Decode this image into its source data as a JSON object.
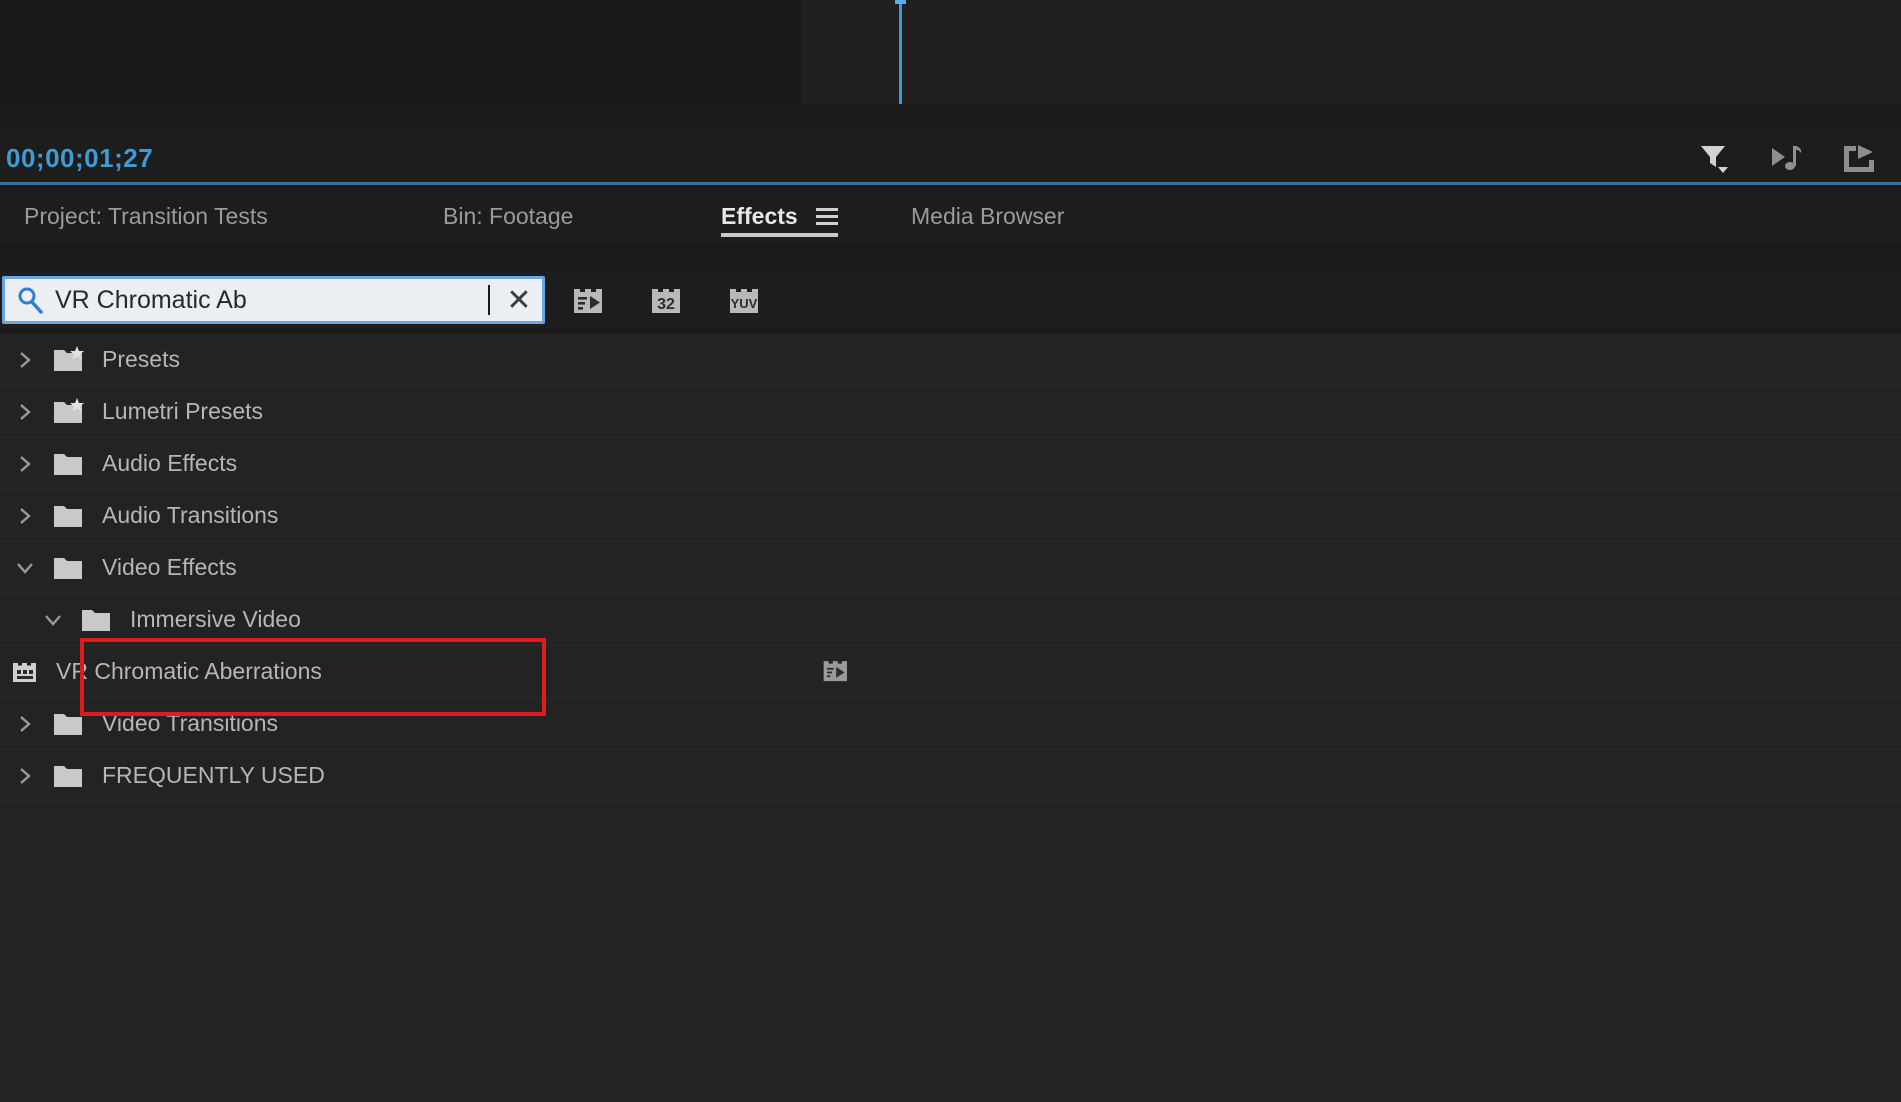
{
  "app": {
    "name": "Adobe Premiere Pro",
    "panel": "Effects"
  },
  "timeline": {
    "timecode": "00;00;01;27",
    "timecode_color": "#3f9bd4",
    "playhead_color": "#3f9bd4",
    "icons": [
      {
        "name": "filter-funnel-icon",
        "title": "Filter"
      },
      {
        "name": "play-audio-icon",
        "title": "Play Audio"
      },
      {
        "name": "export-frame-icon",
        "title": "Export"
      }
    ]
  },
  "tabs": [
    {
      "id": "project",
      "label": "Project: Transition Tests",
      "active": false
    },
    {
      "id": "bin",
      "label": "Bin: Footage",
      "active": false
    },
    {
      "id": "effects",
      "label": "Effects",
      "active": true,
      "menu_icon": "hamburger-icon"
    },
    {
      "id": "media",
      "label": "Media Browser",
      "active": false
    }
  ],
  "search": {
    "value": "VR Chromatic Ab",
    "placeholder": "",
    "icon": "search-icon",
    "clear_label": "✕",
    "focus_color": "#6aa7e0",
    "field_bg": "#eceff1"
  },
  "filters": [
    {
      "name": "accelerated-effects-filter",
      "label": "",
      "title": "Accelerated Effects"
    },
    {
      "name": "32bit-color-filter",
      "label": "32",
      "title": "32-bit Color"
    },
    {
      "name": "yuv-color-filter",
      "label": "YUV",
      "title": "YUV Effects"
    }
  ],
  "tree": [
    {
      "label": "Presets",
      "indent": 0,
      "expanded": false,
      "icon": "folder-preset-icon",
      "twisty": "right"
    },
    {
      "label": "Lumetri Presets",
      "indent": 0,
      "expanded": false,
      "icon": "folder-preset-icon",
      "twisty": "right"
    },
    {
      "label": "Audio Effects",
      "indent": 0,
      "expanded": false,
      "icon": "folder-icon",
      "twisty": "right"
    },
    {
      "label": "Audio Transitions",
      "indent": 0,
      "expanded": false,
      "icon": "folder-icon",
      "twisty": "right"
    },
    {
      "label": "Video Effects",
      "indent": 0,
      "expanded": true,
      "icon": "folder-icon",
      "twisty": "down"
    },
    {
      "label": "Immersive Video",
      "indent": 1,
      "expanded": true,
      "icon": "folder-icon",
      "twisty": "down"
    },
    {
      "label": "VR Chromatic Aberrations",
      "indent": 2,
      "expanded": false,
      "icon": "effect-icon",
      "twisty": "none",
      "badge": "accelerated-effects-icon",
      "highlighted": true
    },
    {
      "label": "Video Transitions",
      "indent": 0,
      "expanded": false,
      "icon": "folder-icon",
      "twisty": "right"
    },
    {
      "label": "FREQUENTLY USED",
      "indent": 0,
      "expanded": false,
      "icon": "folder-icon",
      "twisty": "right"
    }
  ],
  "annotation": {
    "type": "rectangle",
    "color": "#e01b1b",
    "target": "VR Chromatic Aberrations"
  },
  "colors": {
    "panel_bg": "#1d1d1d",
    "list_bg": "#232323",
    "text": "#b6b6b6",
    "accent": "#3f9bd4",
    "annotation": "#e01b1b"
  }
}
